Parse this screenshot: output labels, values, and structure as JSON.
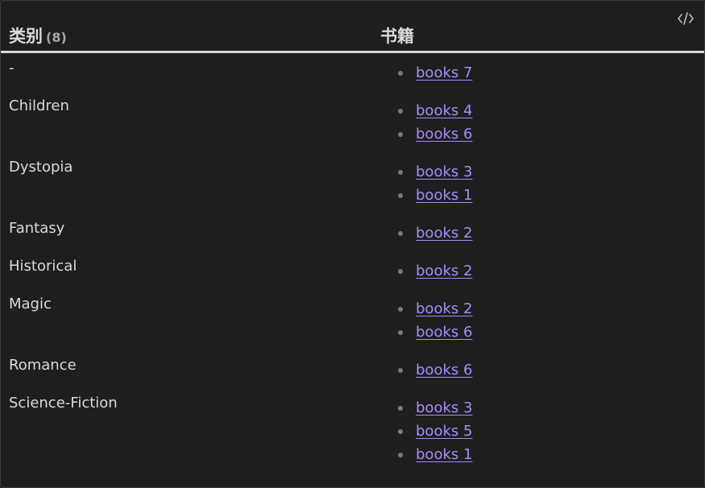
{
  "table": {
    "headers": {
      "category": "类别",
      "category_count": "(8)",
      "books": "书籍"
    },
    "rows": [
      {
        "category": "-",
        "books": [
          "books 7"
        ]
      },
      {
        "category": "Children",
        "books": [
          "books 4",
          "books 6"
        ]
      },
      {
        "category": "Dystopia",
        "books": [
          "books 3",
          "books 1"
        ]
      },
      {
        "category": "Fantasy",
        "books": [
          "books 2"
        ]
      },
      {
        "category": "Historical",
        "books": [
          "books 2"
        ]
      },
      {
        "category": "Magic",
        "books": [
          "books 2",
          "books 6"
        ]
      },
      {
        "category": "Romance",
        "books": [
          "books 6"
        ]
      },
      {
        "category": "Science-Fiction",
        "books": [
          "books 3",
          "books 5",
          "books 1"
        ]
      }
    ]
  },
  "icons": {
    "code_toggle": "code-icon"
  },
  "colors": {
    "background": "#1e1e1e",
    "text": "#dadada",
    "link": "#a88bfa",
    "bullet": "#7a7a7a",
    "header_rule": "#d9d9d9"
  }
}
